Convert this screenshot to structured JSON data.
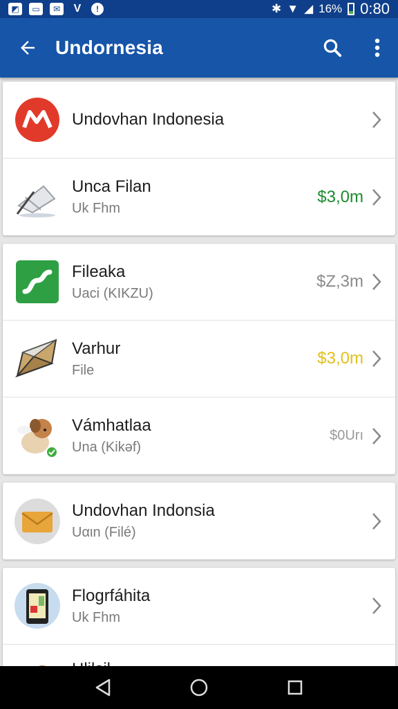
{
  "status_bar": {
    "battery_text": "16%",
    "time": "0:80",
    "left_icons": [
      "image-icon",
      "photo-icon",
      "mail-icon",
      "vpn-icon",
      "info-icon"
    ]
  },
  "app_bar": {
    "title": "Undornesia",
    "color": "#1655a8"
  },
  "cards": [
    {
      "rows": [
        {
          "name": "Undovhan Indonesia",
          "sub": "",
          "price": "",
          "icon": "brand-m-icon"
        },
        {
          "name": "Unca Filan",
          "sub": "Uk Fhm",
          "price": "$3,0m",
          "price_color": "#1d8a2e",
          "icon": "file-edit-icon"
        }
      ]
    },
    {
      "rows": [
        {
          "name": "Fileaka",
          "sub": "Uaci (KIKZU)",
          "price": "$Z,3m",
          "price_color": "#8b8b8b",
          "icon": "green-app-icon"
        },
        {
          "name": "Varhur",
          "sub": "File",
          "price": "$3,0m",
          "price_color": "#e2c01d",
          "icon": "envelope-open-icon"
        },
        {
          "name": "Vámhatlaa",
          "sub": "Una (Kikǝf)",
          "price": "$0Urı",
          "price_color": "#999999",
          "icon": "puppy-icon"
        }
      ]
    },
    {
      "rows": [
        {
          "name": "Undovhan Indonsia",
          "sub": "Uαιn (Filé)",
          "price": "",
          "icon": "mail-envelope-icon"
        }
      ]
    },
    {
      "rows": [
        {
          "name": "Flogrfáhita",
          "sub": "Uk Fhm",
          "price": "",
          "icon": "tablet-icon"
        },
        {
          "name": "Hlilsil",
          "sub": "",
          "price": "",
          "icon": "puppy-icon"
        }
      ]
    }
  ]
}
